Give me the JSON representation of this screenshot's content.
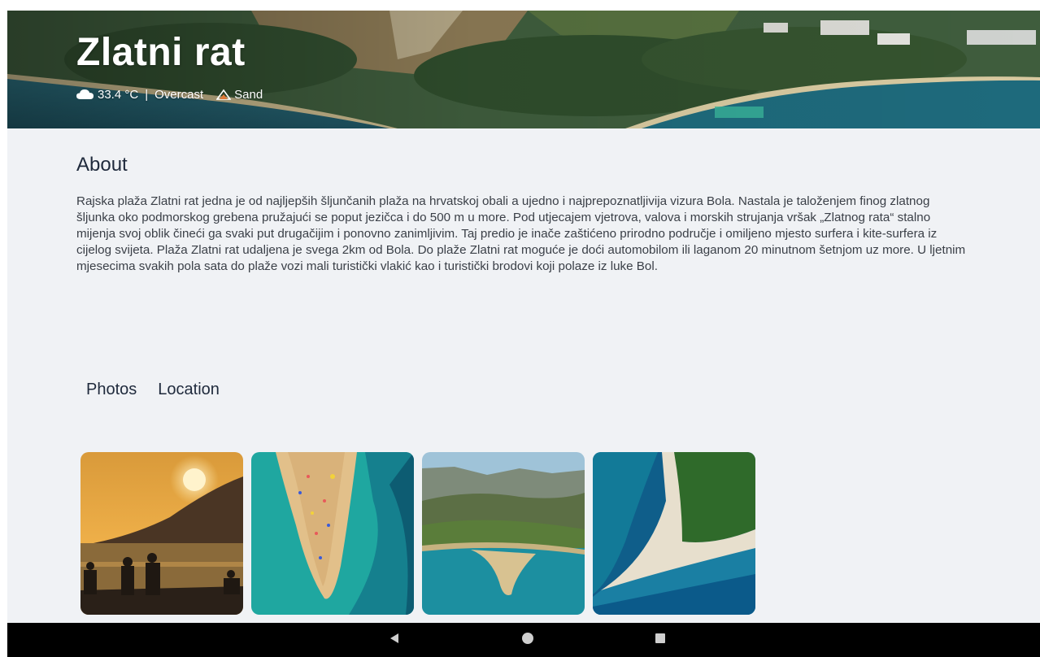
{
  "hero": {
    "title": "Zlatni rat",
    "temperature": "33.4 °C",
    "separator": "|",
    "condition": "Overcast",
    "beach_type": "Sand",
    "weather_icon": "cloud-icon",
    "beach_icon": "sand-icon"
  },
  "about": {
    "title": "About",
    "text": "Rajska plaža Zlatni rat jedna je od najljepših šljunčanih plaža na hrvatskoj obali a ujedno i najprepoznatljivija vizura Bola. Nastala je taloženjem finog zlatnog šljunka oko podmorskog grebena pružajući se poput jezičca i do 500 m u more. Pod utjecajem vjetrova, valova i morskih strujanja vršak „Zlatnog rata“ stalno mijenja svoj oblik čineći ga svaki put drugačijim i ponovno zanimljivim. Taj predio je inače zaštićeno prirodno područje i omiljeno mjesto surfera i kite-surfera iz cijelog svijeta. Plaža Zlatni rat udaljena je svega 2km od Bola. Do plaže Zlatni rat moguće je doći automobilom ili laganom 20 minutnom šetnjom uz more. U ljetnim mjesecima svakih pola sata do plaže vozi mali turistički vlakić kao i turistički brodovi koji polaze iz luke Bol."
  },
  "tabs": [
    {
      "label": "Photos"
    },
    {
      "label": "Location"
    }
  ],
  "navbar": {
    "back_icon": "back-triangle-icon",
    "home_icon": "home-circle-icon",
    "recents_icon": "recents-square-icon"
  },
  "colors": {
    "background": "#f0f2f5",
    "heading": "#1f2a3c",
    "body_text": "#3a3f47",
    "navbar": "#000000"
  }
}
